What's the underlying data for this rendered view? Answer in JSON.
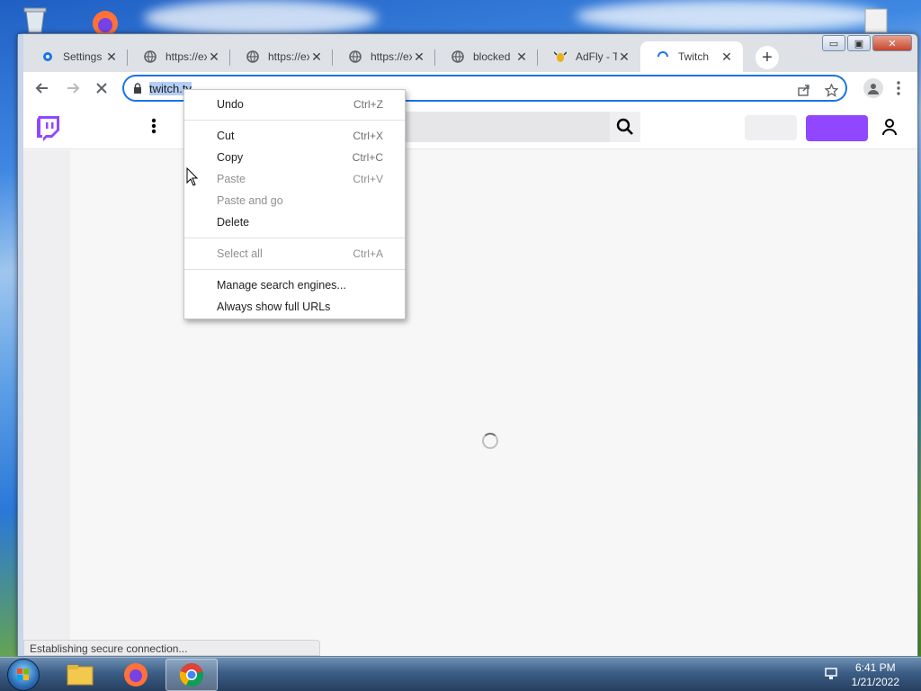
{
  "window": {
    "controls": {
      "minimize": "▭",
      "maximize": "▣",
      "close": "✕"
    }
  },
  "tabs": [
    {
      "title": "Settings",
      "icon": "gear-icon",
      "active": false
    },
    {
      "title": "https://ex",
      "icon": "globe-icon",
      "active": false
    },
    {
      "title": "https://ex",
      "icon": "globe-icon",
      "active": false
    },
    {
      "title": "https://ex",
      "icon": "globe-icon",
      "active": false
    },
    {
      "title": "blocked",
      "icon": "globe-icon",
      "active": false
    },
    {
      "title": "AdFly - T",
      "icon": "adfly-icon",
      "active": false
    },
    {
      "title": "Twitch",
      "icon": "loading-spinner-icon",
      "active": true
    }
  ],
  "newtab_label": "+",
  "omnibox": {
    "url_selected": "twitch.tv",
    "lock_icon": "lock-icon"
  },
  "context_menu": {
    "groups": [
      [
        {
          "label": "Undo",
          "shortcut": "Ctrl+Z",
          "enabled": true
        }
      ],
      [
        {
          "label": "Cut",
          "shortcut": "Ctrl+X",
          "enabled": true
        },
        {
          "label": "Copy",
          "shortcut": "Ctrl+C",
          "enabled": true
        },
        {
          "label": "Paste",
          "shortcut": "Ctrl+V",
          "enabled": false
        },
        {
          "label": "Paste and go",
          "shortcut": "",
          "enabled": false
        },
        {
          "label": "Delete",
          "shortcut": "",
          "enabled": true
        }
      ],
      [
        {
          "label": "Select all",
          "shortcut": "Ctrl+A",
          "enabled": false
        }
      ],
      [
        {
          "label": "Manage search engines...",
          "shortcut": "",
          "enabled": true
        },
        {
          "label": "Always show full URLs",
          "shortcut": "",
          "enabled": true
        }
      ]
    ]
  },
  "status": {
    "text": "Establishing secure connection..."
  },
  "taskbar": {
    "apps": [
      "file-explorer-icon",
      "firefox-icon",
      "chrome-icon"
    ],
    "active_app": "chrome-icon",
    "clock_time": "6:41 PM",
    "clock_date": "1/21/2022"
  },
  "colors": {
    "twitch_purple": "#9147ff",
    "focus_blue": "#1a73e8"
  }
}
